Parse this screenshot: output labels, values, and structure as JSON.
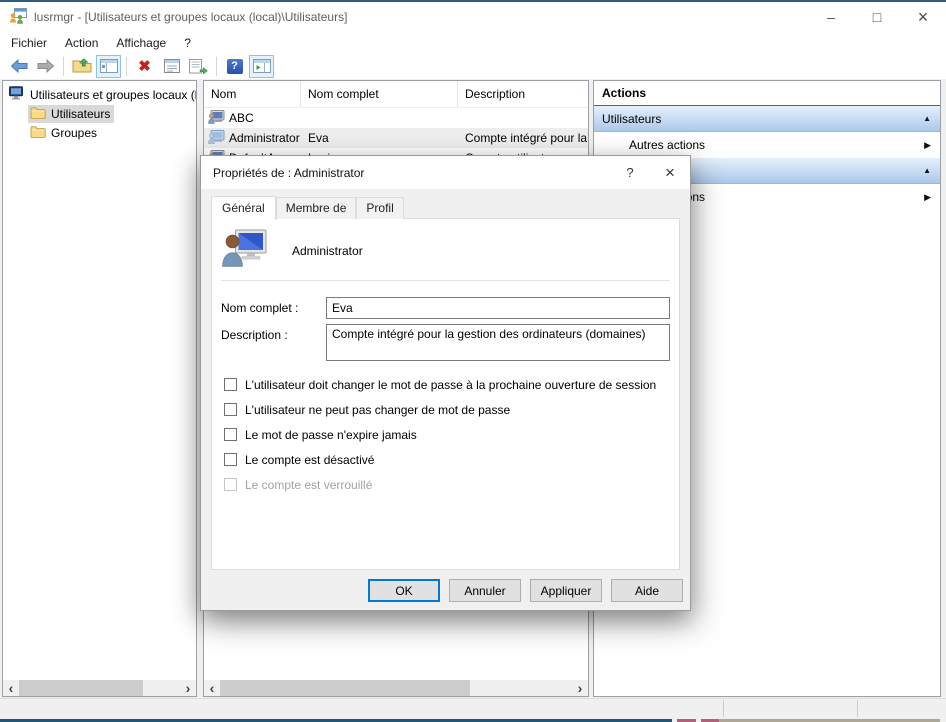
{
  "window": {
    "title": "lusrmgr - [Utilisateurs et groupes locaux (local)\\Utilisateurs]",
    "controls": {
      "minimize": "–",
      "maximize": "□",
      "close": "×"
    }
  },
  "menubar": {
    "items": [
      {
        "label": "Fichier"
      },
      {
        "label": "Action"
      },
      {
        "label": "Affichage"
      },
      {
        "label": "?"
      }
    ]
  },
  "toolbar": {
    "buttons": [
      {
        "name": "back"
      },
      {
        "name": "forward"
      },
      {
        "name": "up-one-level"
      },
      {
        "name": "show-console-tree",
        "toggled": true
      },
      {
        "name": "delete"
      },
      {
        "name": "properties"
      },
      {
        "name": "export-list"
      },
      {
        "name": "help"
      },
      {
        "name": "show-action-pane",
        "toggled": true
      }
    ]
  },
  "tree": {
    "root": {
      "label": "Utilisateurs et groupes locaux (local)"
    },
    "items": [
      {
        "label": "Utilisateurs",
        "selected": true
      },
      {
        "label": "Groupes",
        "selected": false
      }
    ]
  },
  "list": {
    "columns": [
      {
        "label": "Nom"
      },
      {
        "label": "Nom complet"
      },
      {
        "label": "Description"
      }
    ],
    "rows": [
      {
        "nom": "ABC",
        "nom_complet": "",
        "description": "",
        "selected": false
      },
      {
        "nom": "Administrator",
        "nom_complet": "Eva",
        "description": "Compte intégré pour la",
        "selected": true
      },
      {
        "nom": "DefaultAcco",
        "nom_complet": "Lucia",
        "description": "Compte utilisateur pour",
        "selected": false
      }
    ]
  },
  "actions": {
    "title": "Actions",
    "sections": [
      {
        "header": "Utilisateurs",
        "items": [
          {
            "label": "Autres actions"
          }
        ]
      },
      {
        "header": "",
        "items": [
          {
            "label": "Autres actions"
          }
        ]
      }
    ]
  },
  "dialog": {
    "title": "Propriétés de : Administrator",
    "help_button": "?",
    "close_button": "×",
    "tabs": [
      {
        "label": "Général",
        "active": true
      },
      {
        "label": "Membre de",
        "active": false
      },
      {
        "label": "Profil",
        "active": false
      }
    ],
    "user_name": "Administrator",
    "fields": [
      {
        "label": "Nom complet :",
        "value": "Eva"
      },
      {
        "label": "Description :",
        "value": "Compte intégré pour la gestion des ordinateurs (domaines)"
      }
    ],
    "checkboxes": [
      {
        "label": "L'utilisateur doit changer le mot de passe à la prochaine ouverture de session",
        "checked": false,
        "disabled": false
      },
      {
        "label": "L'utilisateur ne peut pas changer de mot de passe",
        "checked": false,
        "disabled": false
      },
      {
        "label": "Le mot de passe n'expire jamais",
        "checked": false,
        "disabled": false
      },
      {
        "label": "Le compte est désactivé",
        "checked": false,
        "disabled": false
      },
      {
        "label": "Le compte est verrouillé",
        "checked": false,
        "disabled": true
      }
    ],
    "buttons": [
      {
        "label": "OK",
        "default": true
      },
      {
        "label": "Annuler",
        "default": false
      },
      {
        "label": "Appliquer",
        "default": false
      },
      {
        "label": "Aide",
        "default": false
      }
    ]
  },
  "glyphs": {
    "scroll_left": "‹",
    "scroll_right": "›",
    "section_collapse": "▲",
    "item_expand": "▶",
    "help": "?"
  },
  "colors": {
    "accent_border": "#2a5d80",
    "selection_inactive": "#d9d9d9",
    "section_header_top": "#e6f0fb",
    "section_header_bottom": "#abc8ea",
    "ok_focus_border": "#0078d7",
    "taskbar_blue": "#20587c",
    "taskbar_rose": "#b5607a",
    "taskbar_tan": "#ada795"
  }
}
